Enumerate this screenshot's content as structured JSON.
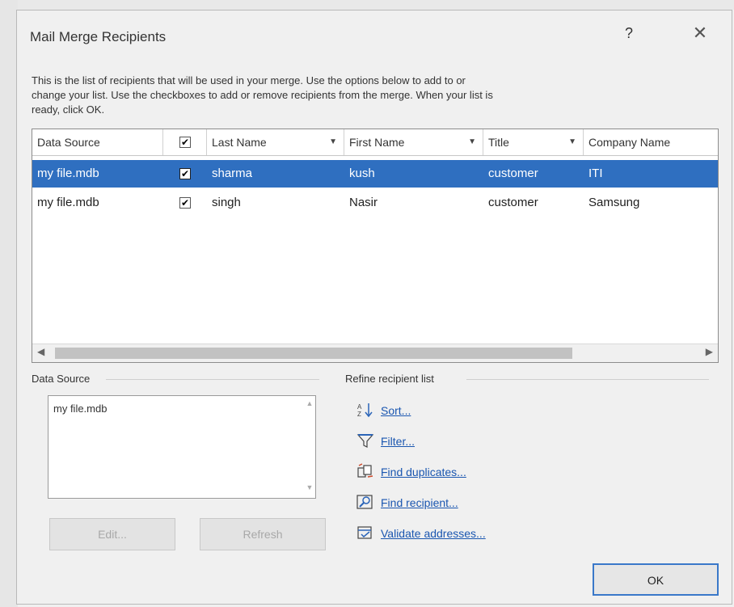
{
  "dialog": {
    "title": "Mail Merge Recipients",
    "help": "?",
    "close": "✕",
    "intro_line1": "This is the list of recipients that will be used in your merge.  Use the options below to add to or",
    "intro_line2": "change your list.  Use the checkboxes to add or remove recipients from the merge.  When your list is",
    "intro_line3": "ready, click OK."
  },
  "table": {
    "columns": [
      "Data Source",
      "",
      "Last Name",
      "First Name",
      "Title",
      "Company Name"
    ],
    "rows": [
      {
        "source": "my file.mdb",
        "checked": true,
        "last": "sharma",
        "first": "kush",
        "title": "customer",
        "company": "ITI",
        "selected": true
      },
      {
        "source": "my file.mdb",
        "checked": true,
        "last": "singh",
        "first": "Nasir",
        "title": "customer",
        "company": "Samsung",
        "selected": false
      }
    ]
  },
  "data_source": {
    "label": "Data Source",
    "items": [
      "my file.mdb"
    ],
    "edit_button": "Edit...",
    "refresh_button": "Refresh"
  },
  "refine": {
    "label": "Refine recipient list",
    "links": [
      {
        "label": "Sort...",
        "icon": "sort-icon"
      },
      {
        "label": "Filter...",
        "icon": "filter-icon"
      },
      {
        "label": "Find duplicates...",
        "icon": "find-duplicates-icon"
      },
      {
        "label": "Find recipient...",
        "icon": "find-recipient-icon"
      },
      {
        "label": "Validate addresses...",
        "icon": "validate-addresses-icon"
      }
    ]
  },
  "ok_button": "OK",
  "colors": {
    "selection": "#2f6fc0",
    "link": "#1a56b0",
    "ok_border": "#3a78c9"
  }
}
